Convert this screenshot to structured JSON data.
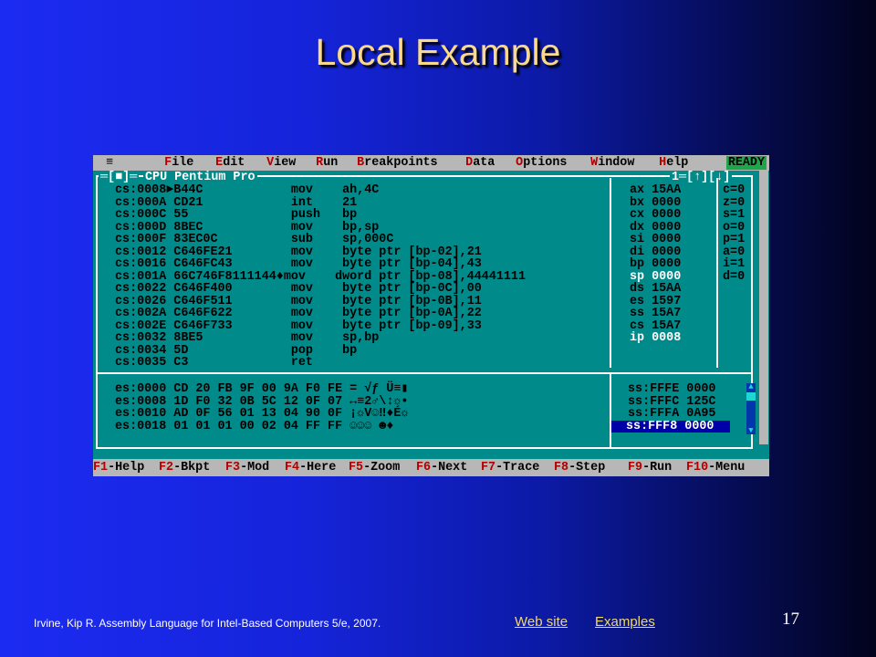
{
  "slide": {
    "title": "Local Example",
    "citation": "Irvine, Kip R. Assembly Language for Intel-Based Computers 5/e, 2007.",
    "link_website": "Web site",
    "link_examples": "Examples",
    "page_number": "17"
  },
  "debugger": {
    "menu": [
      {
        "first": "F",
        "rest": "ile"
      },
      {
        "first": "E",
        "rest": "dit"
      },
      {
        "first": "V",
        "rest": "iew"
      },
      {
        "first": "R",
        "rest": "un"
      },
      {
        "first": "B",
        "rest": "reakpoints"
      },
      {
        "first": "D",
        "rest": "ata"
      },
      {
        "first": "O",
        "rest": "ptions"
      },
      {
        "first": "W",
        "rest": "indow"
      },
      {
        "first": "H",
        "rest": "elp"
      }
    ],
    "system_menu": "≡",
    "ready": "READY",
    "window_title": "CPU Pentium Pro",
    "window_left_controls": "═[■]═",
    "window_right_controls": "1═[↑][↓]",
    "code_lines": [
      "cs:0008►B44C            mov    ah,4C",
      "cs:000A CD21            int    21",
      "cs:000C 55              push   bp",
      "cs:000D 8BEC            mov    bp,sp",
      "cs:000F 83EC0C          sub    sp,000C",
      "cs:0012 C646FE21        mov    byte ptr [bp-02],21",
      "cs:0016 C646FC43        mov    byte ptr [bp-04],43",
      "cs:001A 66C746F8111144♦mov    dword ptr [bp-08],44441111",
      "cs:0022 C646F400        mov    byte ptr [bp-0C],00",
      "cs:0026 C646F511        mov    byte ptr [bp-0B],11",
      "cs:002A C646F622        mov    byte ptr [bp-0A],22",
      "cs:002E C646F733        mov    byte ptr [bp-09],33",
      "cs:0032 8BE5            mov    sp,bp",
      "cs:0034 5D              pop    bp",
      "cs:0035 C3              ret"
    ],
    "registers": [
      {
        "text": "ax 15AA",
        "highlight": false
      },
      {
        "text": "bx 0000",
        "highlight": false
      },
      {
        "text": "cx 0000",
        "highlight": false
      },
      {
        "text": "dx 0000",
        "highlight": false
      },
      {
        "text": "si 0000",
        "highlight": false
      },
      {
        "text": "di 0000",
        "highlight": false
      },
      {
        "text": "bp 0000",
        "highlight": false
      },
      {
        "text": "sp 0000",
        "highlight": true
      },
      {
        "text": "ds 15AA",
        "highlight": false
      },
      {
        "text": "es 1597",
        "highlight": false
      },
      {
        "text": "ss 15A7",
        "highlight": false
      },
      {
        "text": "cs 15A7",
        "highlight": false
      },
      {
        "text": "ip 0008",
        "highlight": true
      }
    ],
    "flags": [
      "c=0",
      "z=0",
      "s=1",
      "o=0",
      "p=1",
      "a=0",
      "i=1",
      "d=0"
    ],
    "memory_lines": [
      "es:0000 CD 20 FB 9F 00 9A F0 FE = √ƒ Ü≡▮",
      "es:0008 1D F0 32 0B 5C 12 0F 07 ↔≡2♂\\↕☼•",
      "es:0010 AD 0F 56 01 13 04 90 0F ¡☼V☺‼♦É☼",
      "es:0018 01 01 01 00 02 04 FF FF ☺☺☺ ☻♦"
    ],
    "stack_lines": [
      {
        "text": "ss:FFFE 0000",
        "selected": false
      },
      {
        "text": "ss:FFFC 125C",
        "selected": false
      },
      {
        "text": "ss:FFFA 0A95",
        "selected": false
      },
      {
        "text": "ss:FFF8 0000",
        "selected": true
      }
    ],
    "status_keys": [
      {
        "key": "F1",
        "label": "-Help"
      },
      {
        "key": "F2",
        "label": "-Bkpt"
      },
      {
        "key": "F3",
        "label": "-Mod"
      },
      {
        "key": "F4",
        "label": "-Here"
      },
      {
        "key": "F5",
        "label": "-Zoom"
      },
      {
        "key": "F6",
        "label": "-Next"
      },
      {
        "key": "F7",
        "label": "-Trace"
      },
      {
        "key": "F8",
        "label": "-Step"
      },
      {
        "key": "F9",
        "label": "-Run"
      },
      {
        "key": "F10",
        "label": "-Menu"
      }
    ]
  }
}
